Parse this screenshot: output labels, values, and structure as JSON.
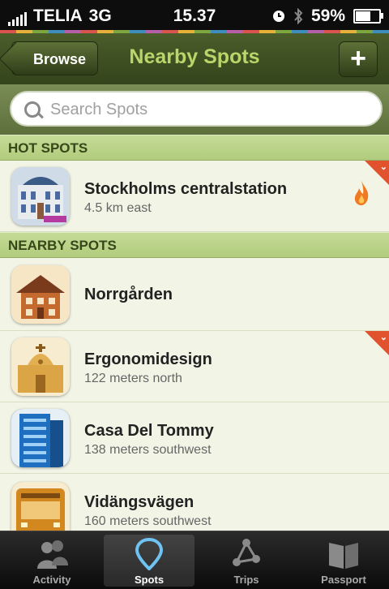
{
  "status_bar": {
    "carrier": "TELIA",
    "network": "3G",
    "time": "15.37",
    "battery": "59%",
    "battery_level": 0.59
  },
  "nav": {
    "back_label": "Browse",
    "title": "Nearby Spots",
    "add_label": "+"
  },
  "search": {
    "placeholder": "Search Spots",
    "value": ""
  },
  "sections": {
    "hot": {
      "label": "HOT SPOTS",
      "items": [
        {
          "name": "Stockholms centralstation",
          "distance": "4.5 km east",
          "icon": "station-building-icon"
        }
      ]
    },
    "nearby": {
      "label": "NEARBY SPOTS",
      "items": [
        {
          "name": "Norrgården",
          "distance": "",
          "icon": "house-icon"
        },
        {
          "name": "Ergonomidesign",
          "distance": "122 meters north",
          "icon": "chapel-icon"
        },
        {
          "name": "Casa Del Tommy",
          "distance": "138 meters southwest",
          "icon": "office-building-icon"
        },
        {
          "name": "Vidängsvägen",
          "distance": "160 meters southwest",
          "icon": "bus-icon"
        }
      ]
    }
  },
  "tabs": [
    {
      "label": "Activity",
      "icon": "people-icon",
      "active": false
    },
    {
      "label": "Spots",
      "icon": "location-pin-icon",
      "active": true
    },
    {
      "label": "Trips",
      "icon": "trip-nodes-icon",
      "active": false
    },
    {
      "label": "Passport",
      "icon": "book-icon",
      "active": false
    }
  ],
  "colors": {
    "accent": "#b8d66a",
    "nav": "#3f5022",
    "section": "#bfd68f",
    "badge": "#e0532e"
  }
}
